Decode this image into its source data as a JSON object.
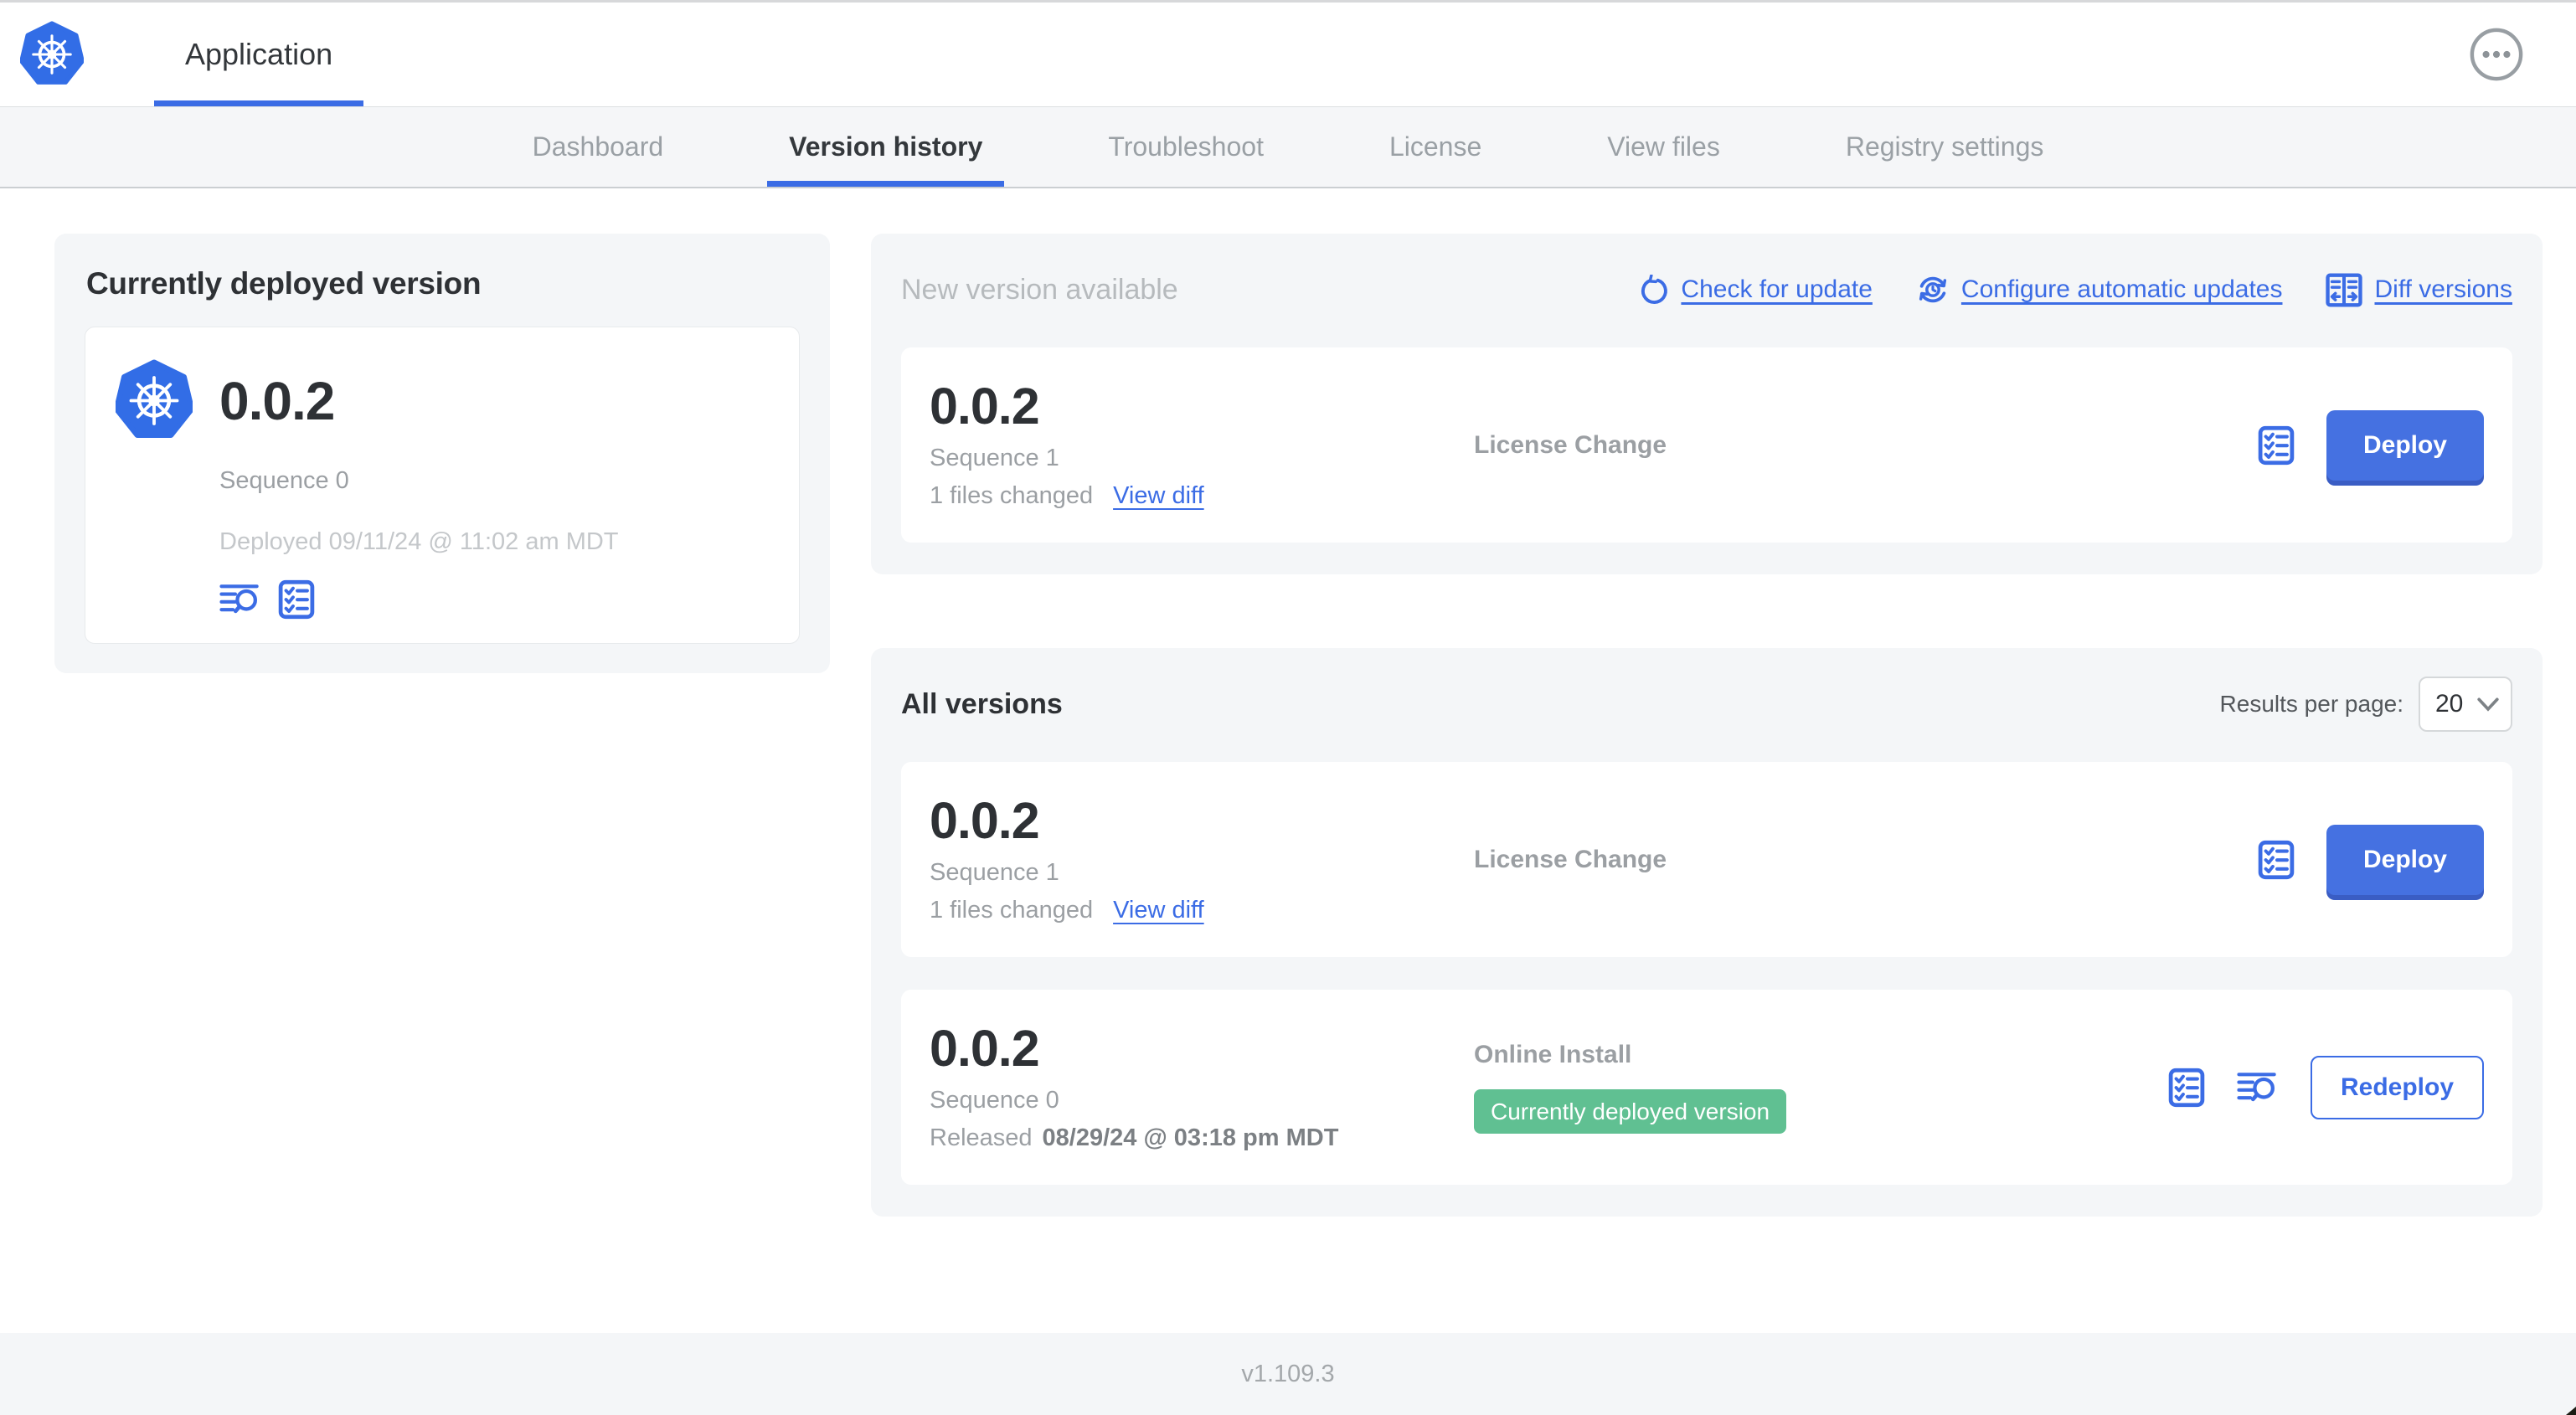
{
  "colors": {
    "accent": "#3b6ce5",
    "button_blue": "#4571e1",
    "button_blue_dark": "#3a5dc4",
    "kubernetes_blue": "#326de6",
    "badge_green": "#60c092",
    "panel_gray": "#f4f6f8"
  },
  "header": {
    "title": "Application"
  },
  "nav": {
    "active": "Version history",
    "tabs": [
      {
        "label": "Dashboard"
      },
      {
        "label": "Version history"
      },
      {
        "label": "Troubleshoot"
      },
      {
        "label": "License"
      },
      {
        "label": "View files"
      },
      {
        "label": "Registry settings"
      }
    ]
  },
  "current": {
    "title": "Currently deployed version",
    "version": "0.0.2",
    "sequence": "Sequence 0",
    "deployed": "Deployed 09/11/24 @ 11:02 am MDT"
  },
  "new_version": {
    "title": "New version available",
    "actions": {
      "check": "Check for update",
      "configure": "Configure automatic updates",
      "diff": "Diff versions"
    },
    "card": {
      "version": "0.0.2",
      "sequence": "Sequence 1",
      "files_changed": "1 files changed",
      "view_diff": "View diff",
      "source": "License Change",
      "deploy": "Deploy"
    }
  },
  "all_versions": {
    "title": "All versions",
    "results_label": "Results per page:",
    "results_value": "20",
    "rows": [
      {
        "version": "0.0.2",
        "sequence": "Sequence 1",
        "files_changed": "1 files changed",
        "view_diff": "View diff",
        "source": "License Change",
        "action": "Deploy"
      },
      {
        "version": "0.0.2",
        "sequence": "Sequence 0",
        "released_prefix": "Released",
        "released_date": "08/29/24 @ 03:18 pm MDT",
        "source": "Online Install",
        "badge": "Currently deployed version",
        "action": "Redeploy"
      }
    ]
  },
  "footer": {
    "app_version": "v1.109.3"
  },
  "icons": {
    "kubernetes-logo": "heptagon-helm-wheel",
    "more-options-icon": "ellipsis-in-circle",
    "check-update-icon": "anticlockwise-arrow",
    "auto-update-icon": "sync-arrows-clock",
    "diff-icon": "split-panes-arrows",
    "preflight-icon": "checklist",
    "logs-icon": "lines-magnifier",
    "select-chevron-icon": "chevron-down"
  }
}
